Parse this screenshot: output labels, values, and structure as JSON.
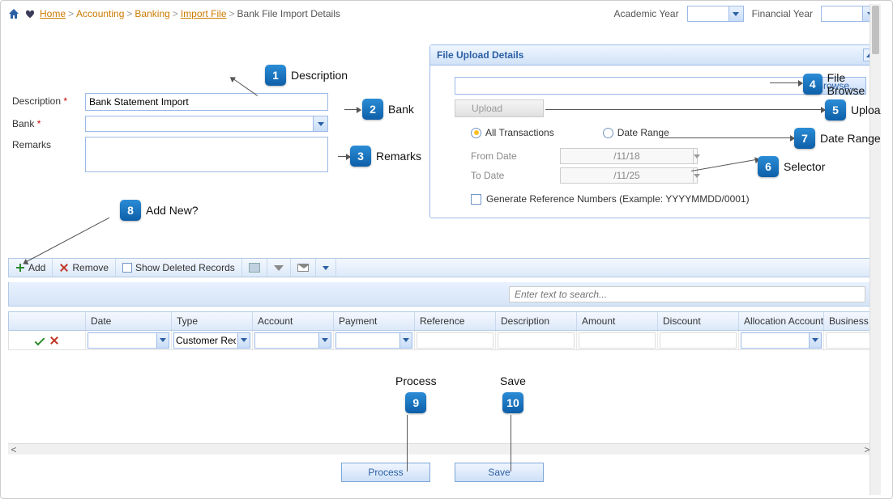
{
  "breadcrumb": {
    "items": [
      "Home",
      "Accounting",
      "Banking",
      "Import File"
    ],
    "current": "Bank File Import Details"
  },
  "yearFilters": {
    "academicLabel": "Academic Year",
    "academicValue": "",
    "financialLabel": "Financial Year",
    "financialValue": ""
  },
  "form": {
    "descriptionLabel": "Description",
    "descriptionValue": "Bank Statement Import",
    "bankLabel": "Bank",
    "bankValue": "",
    "remarksLabel": "Remarks",
    "remarksValue": ""
  },
  "panel": {
    "title": "File Upload Details",
    "fileValue": "",
    "browseLabel": "Browse...",
    "uploadLabel": "Upload",
    "radioAll": "All Transactions",
    "radioRange": "Date Range",
    "fromLabel": "From Date",
    "fromValue": "/11/18",
    "toLabel": "To Date",
    "toValue": "/11/25",
    "generateRefLabel": "Generate Reference Numbers (Example: YYYYMMDD/0001)"
  },
  "toolbar": {
    "add": "Add",
    "remove": "Remove",
    "showDeleted": "Show Deleted Records"
  },
  "search": {
    "placeholder": "Enter text to search..."
  },
  "grid": {
    "columns": [
      "",
      "Date",
      "Type",
      "Account",
      "Payment",
      "Reference",
      "Description",
      "Amount",
      "Discount",
      "Allocation Account",
      "Business Unit"
    ],
    "row0": {
      "type": "Customer Rec"
    }
  },
  "actions": {
    "process": "Process",
    "save": "Save"
  },
  "callouts": {
    "c1": "Description",
    "c2": "Bank",
    "c3": "Remarks",
    "c4": "File Browse",
    "c5": "Upload",
    "c6": "Selector",
    "c7": "Date Range",
    "c8": "Add New?",
    "c9": "Process",
    "c10": "Save"
  }
}
